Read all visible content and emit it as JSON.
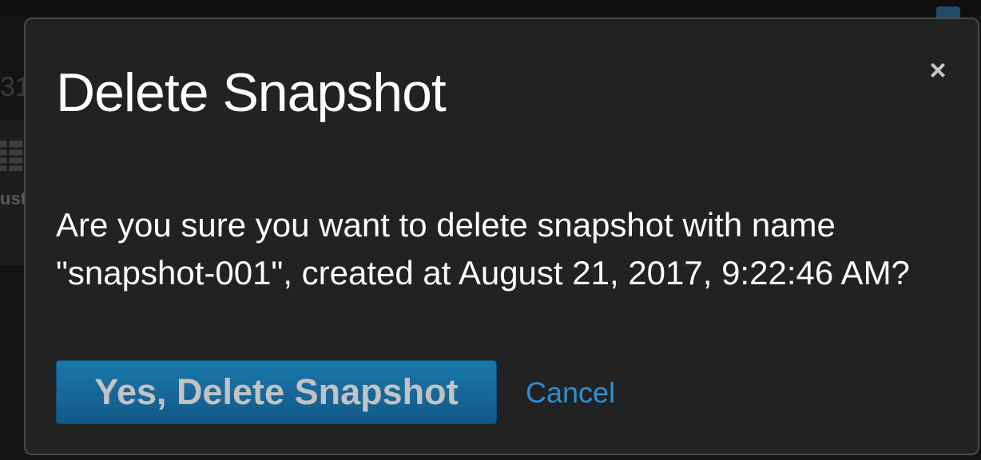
{
  "background": {
    "partial_number": "31",
    "partial_text": "ust"
  },
  "modal": {
    "title": "Delete Snapshot",
    "close_icon": "close-icon",
    "close_symbol": "×",
    "message": "Are you sure you want to delete snapshot with name \"snapshot-001\", created at August 21, 2017, 9:22:46 AM?",
    "confirm_label": "Yes, Delete Snapshot",
    "cancel_label": "Cancel"
  },
  "colors": {
    "modal_background": "#222222",
    "primary_button": "#1c77ad",
    "cancel_link": "#2f8fd0",
    "title_text": "#ffffff"
  }
}
